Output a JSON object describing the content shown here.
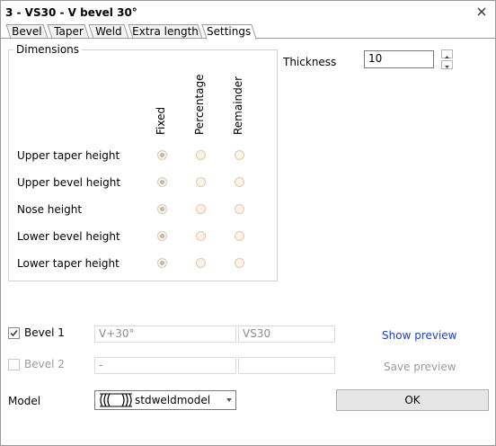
{
  "window": {
    "title": "3 - VS30 - V bevel 30°"
  },
  "tabs": [
    {
      "label": "Bevel"
    },
    {
      "label": "Taper"
    },
    {
      "label": "Weld"
    },
    {
      "label": "Extra length"
    },
    {
      "label": "Settings"
    }
  ],
  "active_tab": "Settings",
  "dimensions": {
    "group_label": "Dimensions",
    "columns": [
      "Fixed",
      "Percentage",
      "Remainder"
    ],
    "rows": [
      {
        "label": "Upper taper height",
        "selected": "Fixed"
      },
      {
        "label": "Upper bevel height",
        "selected": "Fixed"
      },
      {
        "label": "Nose height",
        "selected": "Fixed"
      },
      {
        "label": "Lower bevel height",
        "selected": "Fixed"
      },
      {
        "label": "Lower taper height",
        "selected": "Fixed"
      }
    ]
  },
  "thickness": {
    "label": "Thickness",
    "value": "10"
  },
  "bevel1": {
    "label": "Bevel 1",
    "checked": true,
    "type_value": "V+30°",
    "name_value": "VS30",
    "link": "Show preview"
  },
  "bevel2": {
    "label": "Bevel 2",
    "checked": false,
    "type_value": "-",
    "name_value": "",
    "link": "Save preview"
  },
  "model": {
    "label": "Model",
    "value": "stdweldmodel"
  },
  "ok_button": {
    "label": "OK"
  },
  "colors": {
    "link_blue": "#1f3fbf",
    "disabled_text": "#9a9a9a",
    "radio_border": "#e3c9a6"
  },
  "icons": {
    "close": "close-icon",
    "model": "weld-model-icon",
    "dropdown": "chevron-down-icon",
    "spin_up": "spin-up-icon",
    "spin_down": "spin-down-icon",
    "check": "check-icon"
  }
}
